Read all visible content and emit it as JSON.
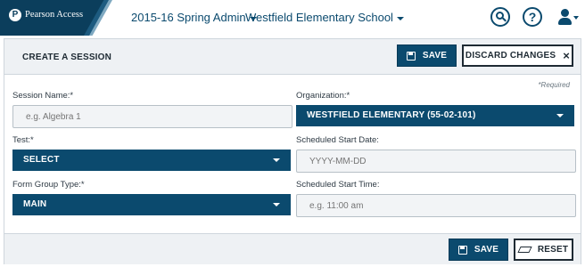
{
  "brand": {
    "logo_letter": "P",
    "name": "Pearson Access"
  },
  "nav": {
    "admin": "2015-16 Spring Admin",
    "school": "Westfield Elementary School"
  },
  "icons": {
    "search": "search-icon",
    "help": "help-icon",
    "help_glyph": "?",
    "user": "user-icon"
  },
  "panel": {
    "title": "CREATE A SESSION",
    "save_label": "SAVE",
    "discard_label": "DISCARD CHANGES",
    "required_note": "*Required"
  },
  "form": {
    "session_name": {
      "label": "Session Name:*",
      "placeholder": "e.g. Algebra 1"
    },
    "organization": {
      "label": "Organization:*",
      "value": "WESTFIELD ELEMENTARY (55-02-101)"
    },
    "test": {
      "label": "Test:*",
      "value": "SELECT"
    },
    "start_date": {
      "label": "Scheduled Start Date:",
      "placeholder": "YYYY-MM-DD"
    },
    "form_group": {
      "label": "Form Group Type:*",
      "value": "MAIN"
    },
    "start_time": {
      "label": "Scheduled Start Time:",
      "placeholder": "e.g. 11:00 am"
    }
  },
  "footer": {
    "save_label": "SAVE",
    "reset_label": "RESET"
  },
  "colors": {
    "primary": "#0b4a6e",
    "brand_dark": "#0b3e5c",
    "panel_bg": "#eef1f4"
  }
}
